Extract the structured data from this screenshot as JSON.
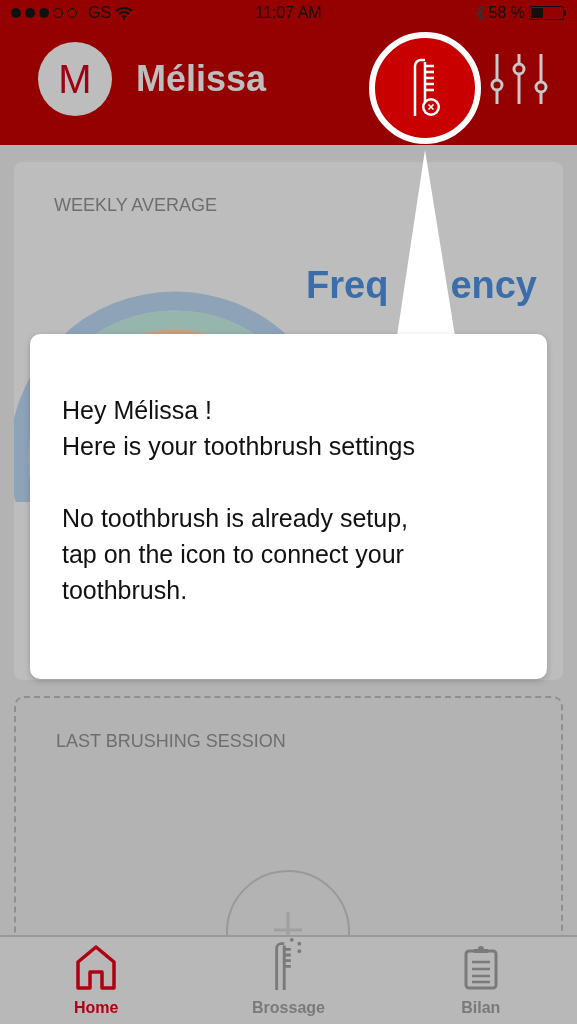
{
  "status_bar": {
    "carrier": "GS",
    "time": "11:07 AM",
    "battery": "58 %"
  },
  "header": {
    "avatar_letter": "M",
    "name": "Mélissa"
  },
  "weekly_card": {
    "title": "WEEKLY AVERAGE",
    "metric_fragments": [
      "Freq",
      "ency"
    ]
  },
  "session_card": {
    "title": "LAST BRUSHING SESSION"
  },
  "tooltip": {
    "paragraphs": [
      "Hey Mélissa !\nHere is your toothbrush settings",
      "No toothbrush is already setup,\ntap on the icon to connect your\ntoothbrush."
    ]
  },
  "tabs": [
    {
      "label": "Home",
      "kind": "home",
      "selected": true
    },
    {
      "label": "Brossage",
      "kind": "brush",
      "selected": false
    },
    {
      "label": "Bilan",
      "kind": "report",
      "selected": false
    }
  ]
}
